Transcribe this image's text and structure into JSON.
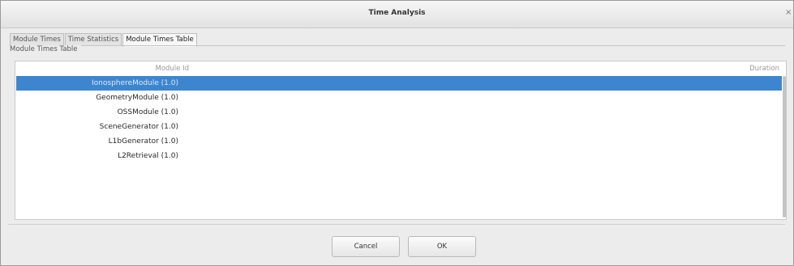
{
  "window": {
    "title": "Time Analysis",
    "close_glyph": "×"
  },
  "tabs": [
    {
      "label": "Module Times",
      "active": false
    },
    {
      "label": "Time Statistics",
      "active": false
    },
    {
      "label": "Module Times Table",
      "active": true
    }
  ],
  "group": {
    "label": "Module Times Table"
  },
  "table": {
    "headers": {
      "module": "Module Id",
      "duration": "Duration"
    },
    "rows": [
      {
        "module": "IonosphereModule (1.0)",
        "duration": "",
        "selected": true
      },
      {
        "module": "GeometryModule (1.0)",
        "duration": ""
      },
      {
        "module": "OSSModule (1.0)",
        "duration": ""
      },
      {
        "module": "SceneGenerator (1.0)",
        "duration": ""
      },
      {
        "module": "L1bGenerator (1.0)",
        "duration": ""
      },
      {
        "module": "L2Retrieval (1.0)",
        "duration": ""
      }
    ]
  },
  "buttons": {
    "cancel": "Cancel",
    "ok": "OK"
  },
  "colors": {
    "selection": "#3d86cf",
    "background": "#ececec"
  }
}
